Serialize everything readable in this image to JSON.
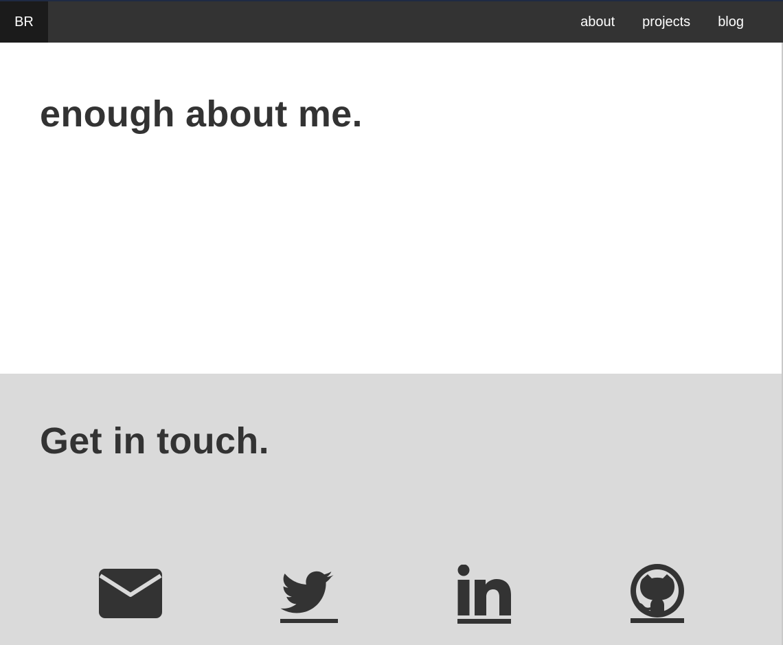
{
  "nav": {
    "brand": "BR",
    "links": [
      {
        "label": "about"
      },
      {
        "label": "projects"
      },
      {
        "label": "blog"
      }
    ]
  },
  "about": {
    "heading": "enough about me."
  },
  "contact": {
    "heading": "Get in touch.",
    "icons": [
      "envelope-icon",
      "twitter-icon",
      "linkedin-icon",
      "github-icon"
    ]
  },
  "colors": {
    "navbar": "#333333",
    "brand_bg": "#1b1b1b",
    "text_dark": "#333333",
    "contact_bg": "#dadada",
    "accent_line": "#1f2a44"
  }
}
